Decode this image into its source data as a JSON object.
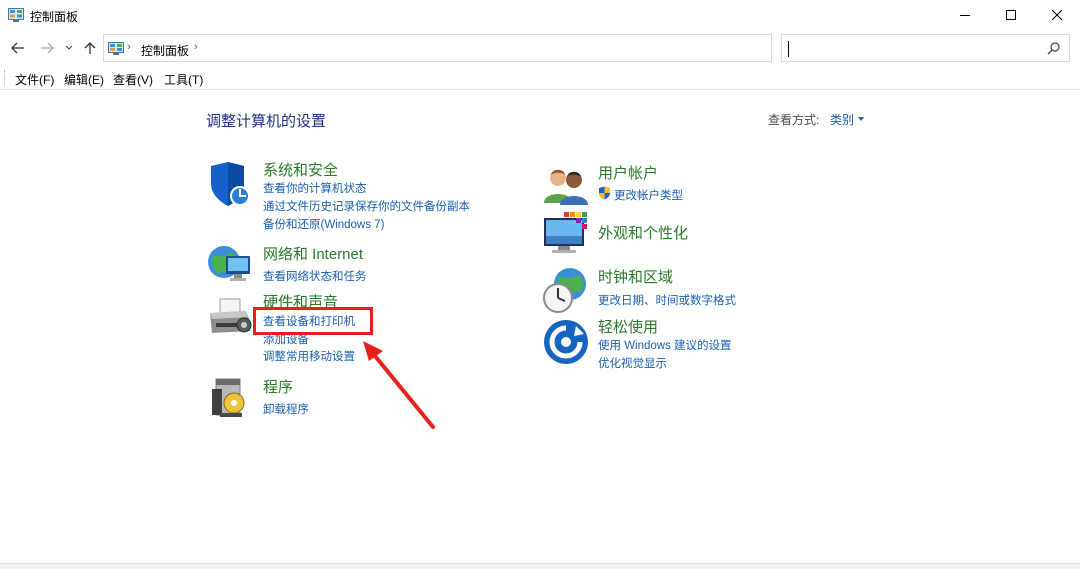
{
  "window": {
    "title": "控制面板",
    "controls": [
      "minimize",
      "maximize",
      "close"
    ]
  },
  "address": {
    "breadcrumb": [
      "控制面板"
    ],
    "search_value": ""
  },
  "menu": {
    "items": [
      "文件(F)",
      "编辑(E)",
      "查看(V)",
      "工具(T)"
    ]
  },
  "content": {
    "title": "调整计算机的设置",
    "view_by_label": "查看方式:",
    "view_by_value": "类别"
  },
  "categories": {
    "system_security": {
      "title": "系统和安全",
      "icon": "shield-icon",
      "links": [
        "查看你的计算机状态",
        "通过文件历史记录保存你的文件备份副本",
        "备份和还原(Windows 7)"
      ]
    },
    "network": {
      "title": "网络和 Internet",
      "icon": "network-globe-icon",
      "links": [
        "查看网络状态和任务"
      ]
    },
    "hardware": {
      "title": "硬件和声音",
      "icon": "printer-icon",
      "links": [
        "查看设备和打印机",
        "添加设备",
        "调整常用移动设置"
      ]
    },
    "programs": {
      "title": "程序",
      "icon": "programs-disc-icon",
      "links": [
        "卸载程序"
      ]
    },
    "user_accounts": {
      "title": "用户帐户",
      "icon": "users-icon",
      "links": [
        "更改帐户类型"
      ]
    },
    "appearance": {
      "title": "外观和个性化",
      "icon": "monitor-palette-icon",
      "links": []
    },
    "clock_region": {
      "title": "时钟和区域",
      "icon": "clock-globe-icon",
      "links": [
        "更改日期、时间或数字格式"
      ]
    },
    "ease_of_access": {
      "title": "轻松使用",
      "icon": "ease-of-access-icon",
      "links": [
        "使用 Windows 建议的设置",
        "优化视觉显示"
      ]
    }
  },
  "colors": {
    "title_blue": "#1e3287",
    "link_blue": "#1a5fb4",
    "category_green": "#2a7a2a",
    "highlight_red": "#e8201c"
  }
}
